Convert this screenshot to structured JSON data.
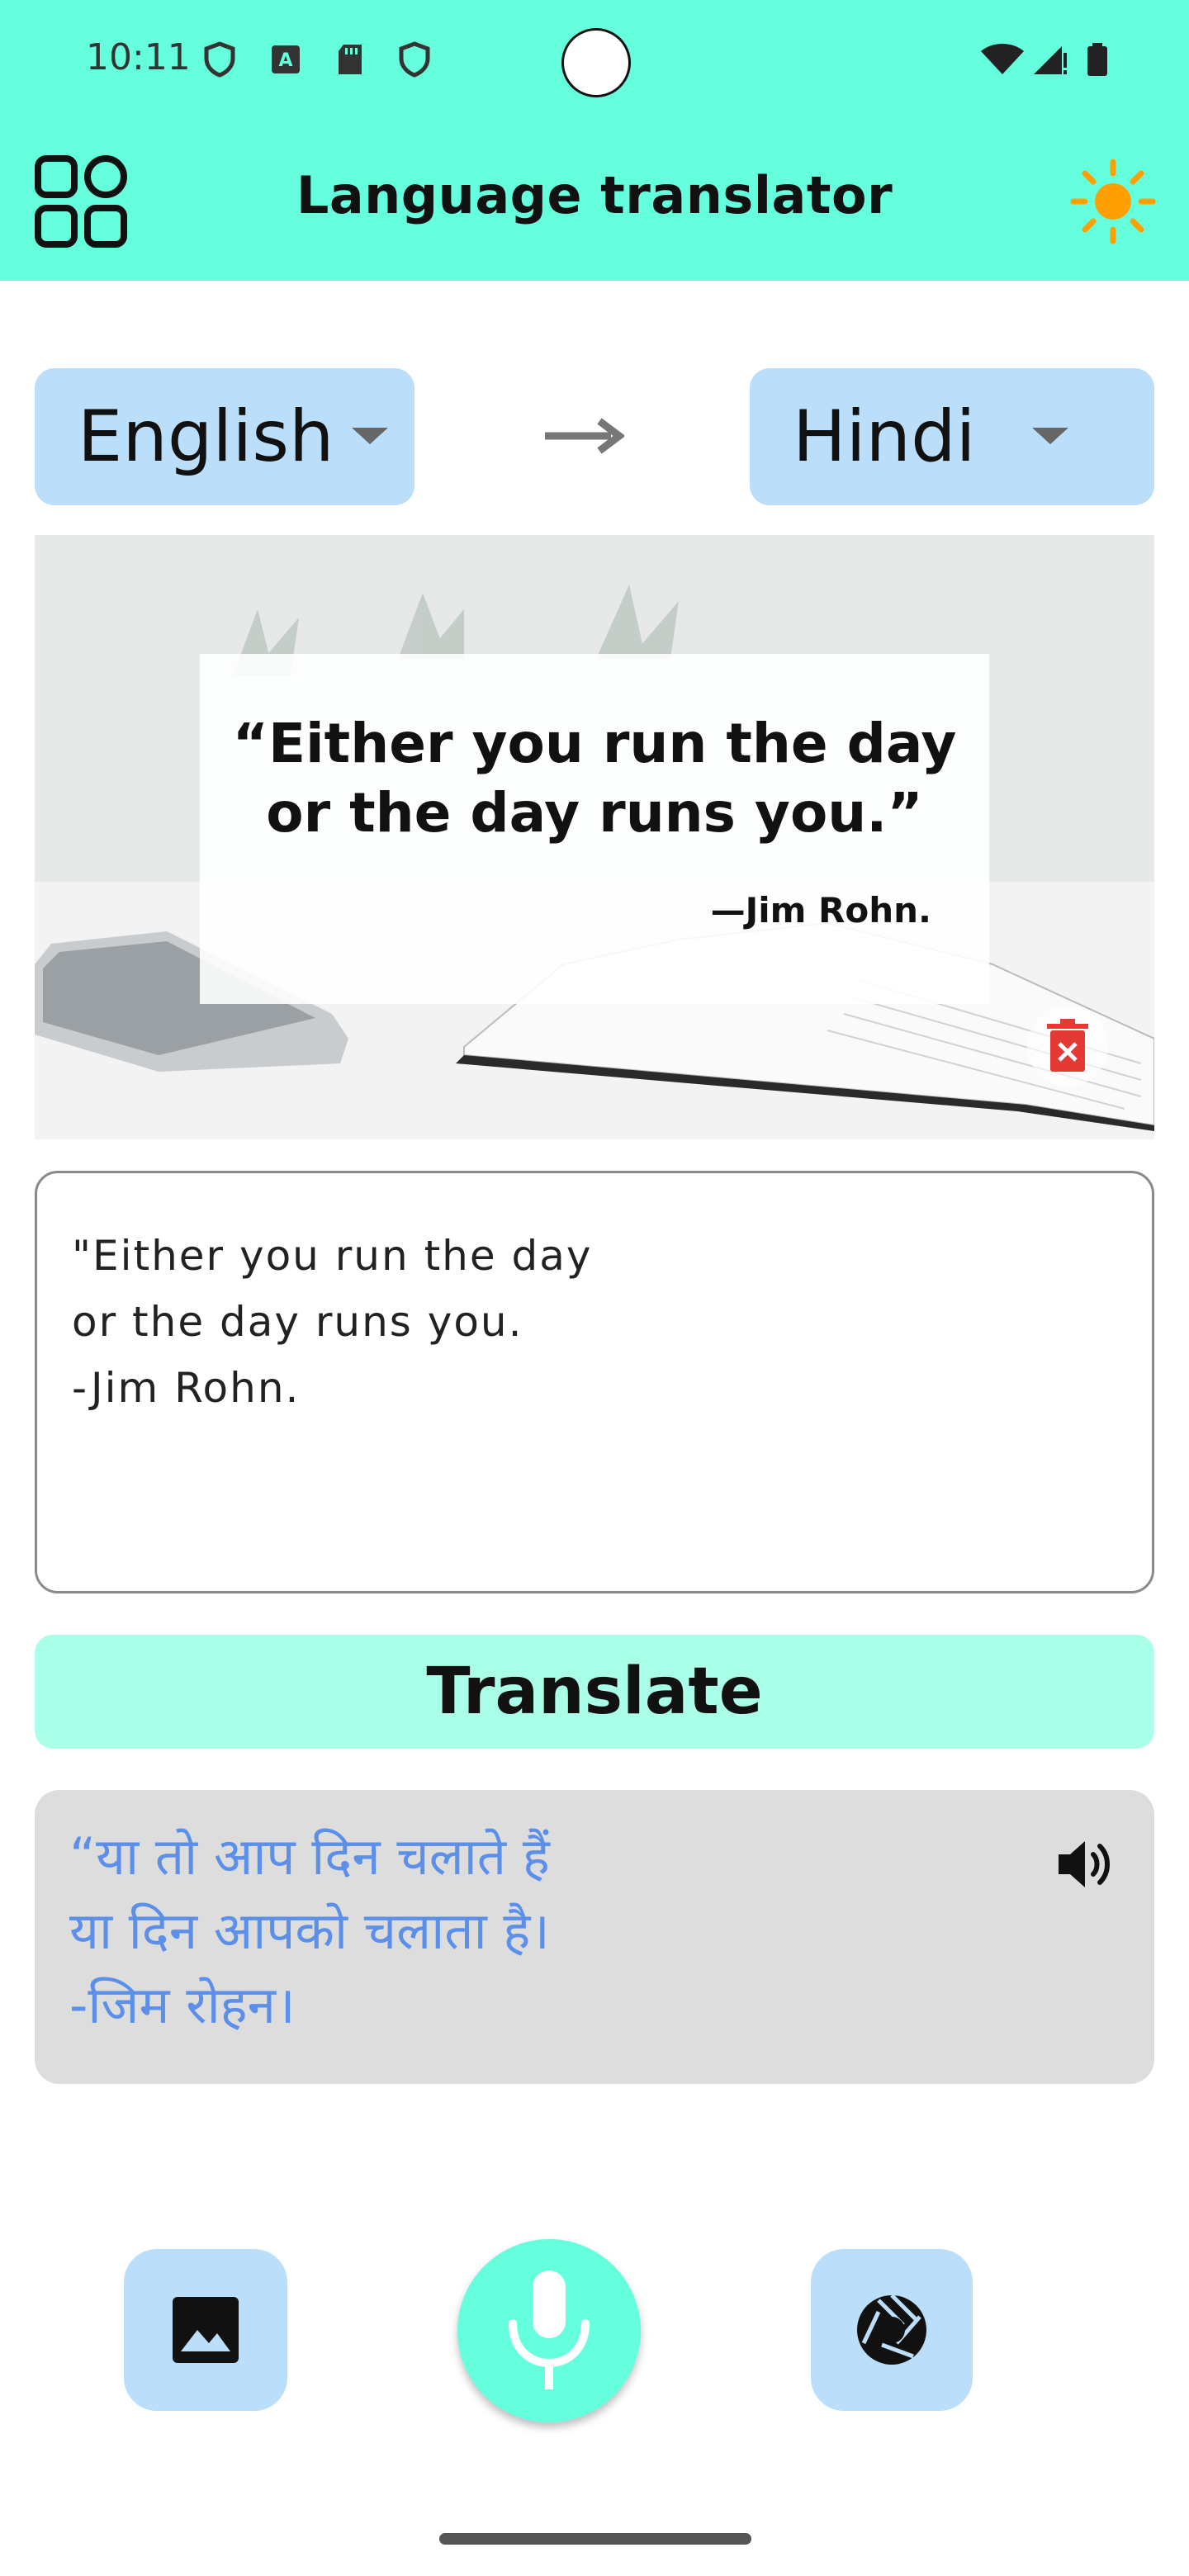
{
  "status_bar": {
    "time": "10:11",
    "left_icons": [
      "shield-icon",
      "accessibility-a-icon",
      "sd-card-icon",
      "shield-icon"
    ],
    "right_icons": [
      "wifi-icon",
      "signal-icon",
      "battery-icon"
    ]
  },
  "header": {
    "title": "Language translator",
    "left_icon": "grid-apps-icon",
    "right_icon": "sun-icon",
    "background": "#66ffdd",
    "sun_color": "#ffa000"
  },
  "languages": {
    "source": "English",
    "target": "Hindi",
    "arrow_icon": "arrow-right-icon",
    "box_color": "#bbdefa"
  },
  "image": {
    "quote_line_1": "“Either you run the day",
    "quote_line_2": "or the day runs you.”",
    "quote_author": "—Jim Rohn.",
    "delete_icon": "delete-icon",
    "delete_color": "#e53935"
  },
  "source_text": {
    "line_1": "\"Either you run the day",
    "line_2": "or the day runs you.",
    "line_3": "-Jim Rohn."
  },
  "translate_button": {
    "label": "Translate",
    "color": "#aaffe9"
  },
  "output": {
    "line_1": "“या तो आप दिन चलाते हैं",
    "line_2": "या दिन आपको चलाता है।",
    "line_3": "-जिम रोहन।",
    "text_color": "#5b8fea",
    "speaker_icon": "speaker-icon"
  },
  "bottom_bar": {
    "gallery_icon": "image-icon",
    "mic_icon": "microphone-icon",
    "camera_icon": "camera-shutter-icon"
  }
}
